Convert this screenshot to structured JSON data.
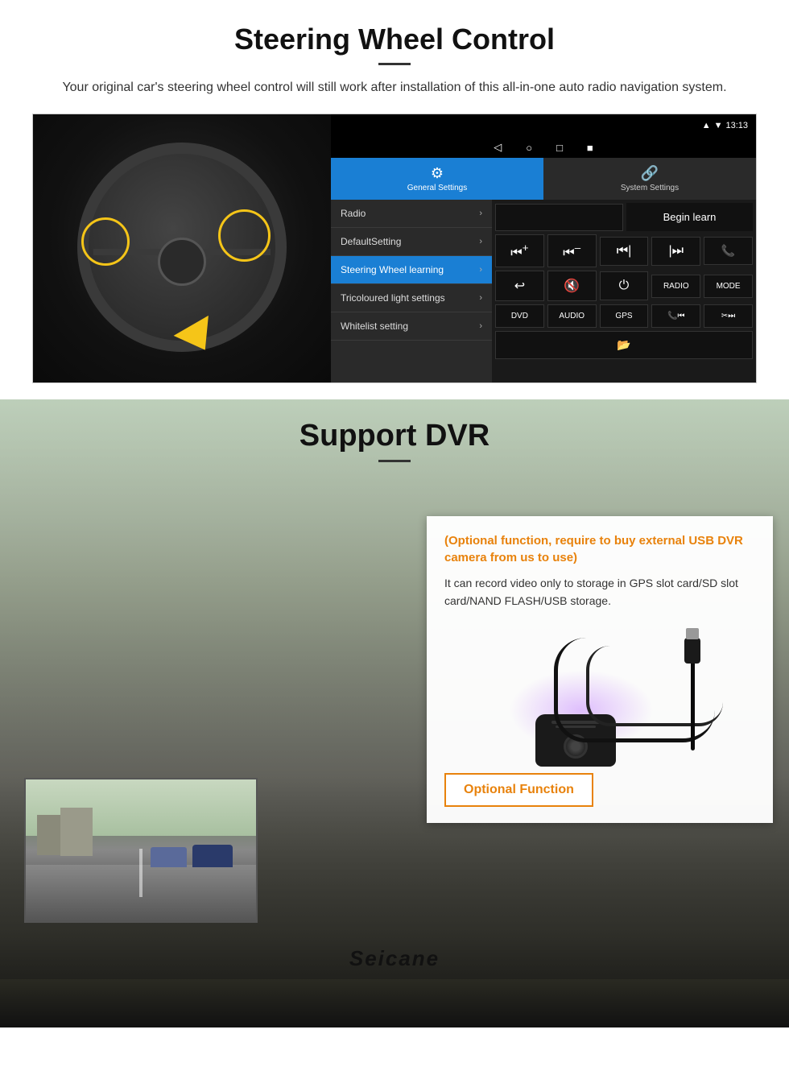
{
  "steering": {
    "title": "Steering Wheel Control",
    "desc": "Your original car's steering wheel control will still work after installation of this all-in-one auto radio navigation system.",
    "android": {
      "statusBar": {
        "time": "13:13",
        "icons": [
          "signal",
          "wifi"
        ]
      },
      "topBar": {
        "general": {
          "icon": "⚙",
          "label": "General Settings"
        },
        "system": {
          "icon": "🔗",
          "label": "System Settings"
        }
      },
      "menuItems": [
        {
          "label": "Radio",
          "active": false
        },
        {
          "label": "DefaultSetting",
          "active": false
        },
        {
          "label": "Steering Wheel learning",
          "active": true
        },
        {
          "label": "Tricoloured light settings",
          "active": false
        },
        {
          "label": "Whitelist setting",
          "active": false
        }
      ],
      "beginLearnBtn": "Begin learn",
      "navBtns": [
        "◁",
        "○",
        "□",
        "■"
      ],
      "ctrlButtons": {
        "row1": [
          "⏮+",
          "⏮–",
          "⏮|",
          "|⏭",
          "📞"
        ],
        "row2": [
          "↩",
          "🔇x",
          "⏻",
          "RADIO",
          "MODE"
        ],
        "row3": [
          "DVD",
          "AUDIO",
          "GPS",
          "📞⏮|",
          "✂⏭|"
        ]
      }
    }
  },
  "dvr": {
    "title": "Support DVR",
    "optional_notice": "(Optional function, require to buy external USB DVR camera from us to use)",
    "desc": "It can record video only to storage in GPS slot card/SD slot card/NAND FLASH/USB storage.",
    "optional_btn": "Optional Function",
    "brand": "Seicane"
  }
}
